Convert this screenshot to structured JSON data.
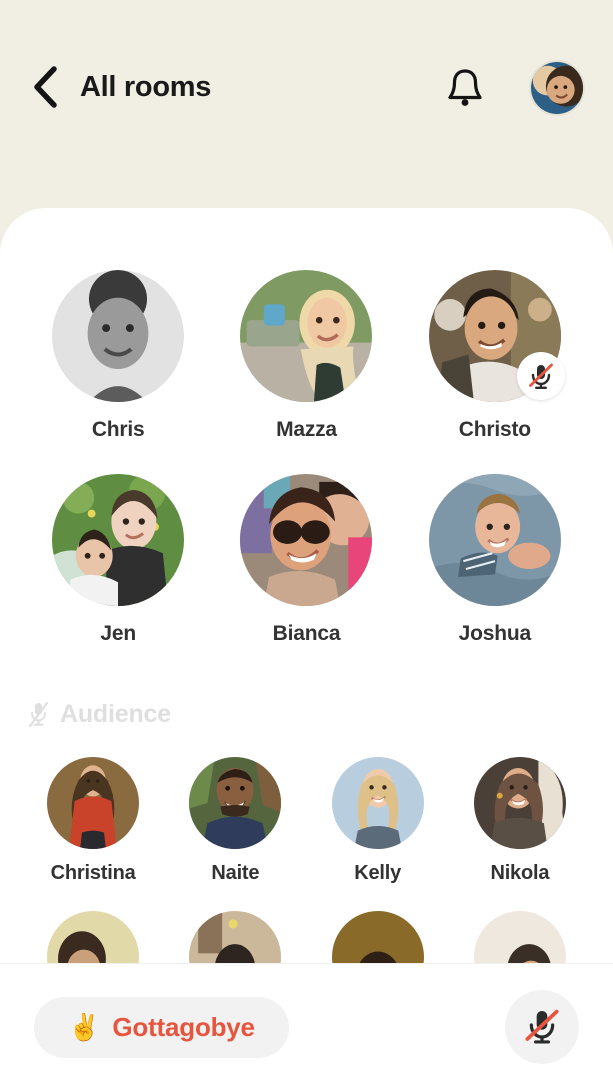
{
  "header": {
    "back_icon": "chevron-left-icon",
    "title": "All rooms",
    "bell_icon": "bell-icon",
    "avatar_icon": "user-avatar"
  },
  "stage": {
    "speakers": [
      {
        "name": "Chris",
        "muted": false,
        "c1": "#d8d8d8",
        "c2": "#9e9e9e",
        "c3": "#4a4a4a"
      },
      {
        "name": "Mazza",
        "muted": false,
        "c1": "#8aa36a",
        "c2": "#d9c9a6",
        "c3": "#3c4a38"
      },
      {
        "name": "Christo",
        "muted": true,
        "c1": "#7d6a52",
        "c2": "#caa887",
        "c3": "#2e2a22"
      },
      {
        "name": "Jen",
        "muted": false,
        "c1": "#6f9b4e",
        "c2": "#e3cdb6",
        "c3": "#2f3a28"
      },
      {
        "name": "Bianca",
        "muted": false,
        "c1": "#b07a5e",
        "c2": "#e8c2a4",
        "c3": "#3a2a22"
      },
      {
        "name": "Joshua",
        "muted": false,
        "c1": "#7f96a8",
        "c2": "#bdd0de",
        "c3": "#3d4a56"
      }
    ]
  },
  "audience": {
    "label": "Audience",
    "mic_icon": "mic-muted-icon",
    "members": [
      {
        "name": "Christina",
        "c1": "#8a6b3f",
        "c2": "#c9432b",
        "c3": "#4a3520"
      },
      {
        "name": "Naite",
        "c1": "#5a6b4a",
        "c2": "#2f3c5c",
        "c3": "#7d5f3e"
      },
      {
        "name": "Kelly",
        "c1": "#b8cddd",
        "c2": "#e6cfae",
        "c3": "#5c6b7a"
      },
      {
        "name": "Nikola",
        "c1": "#6e5f52",
        "c2": "#d2b79a",
        "c3": "#3a3028"
      }
    ],
    "partial_members": [
      {
        "c1": "#e2d9a8",
        "c2": "#3a2a20"
      },
      {
        "c1": "#cbb79a",
        "c2": "#2e2520"
      },
      {
        "c1": "#8a6a28",
        "c2": "#e8cba0"
      },
      {
        "c1": "#efe8df",
        "c2": "#3a2f26"
      }
    ]
  },
  "footer": {
    "leave_emoji": "✌️",
    "leave_label": "Gottagobye",
    "mic_icon": "mic-muted-icon"
  },
  "colors": {
    "page_background": "#f1efe3",
    "sheet_background": "#ffffff",
    "accent_red": "#e8553f",
    "name_text": "#333333",
    "audience_text": "#dfdfdf"
  }
}
